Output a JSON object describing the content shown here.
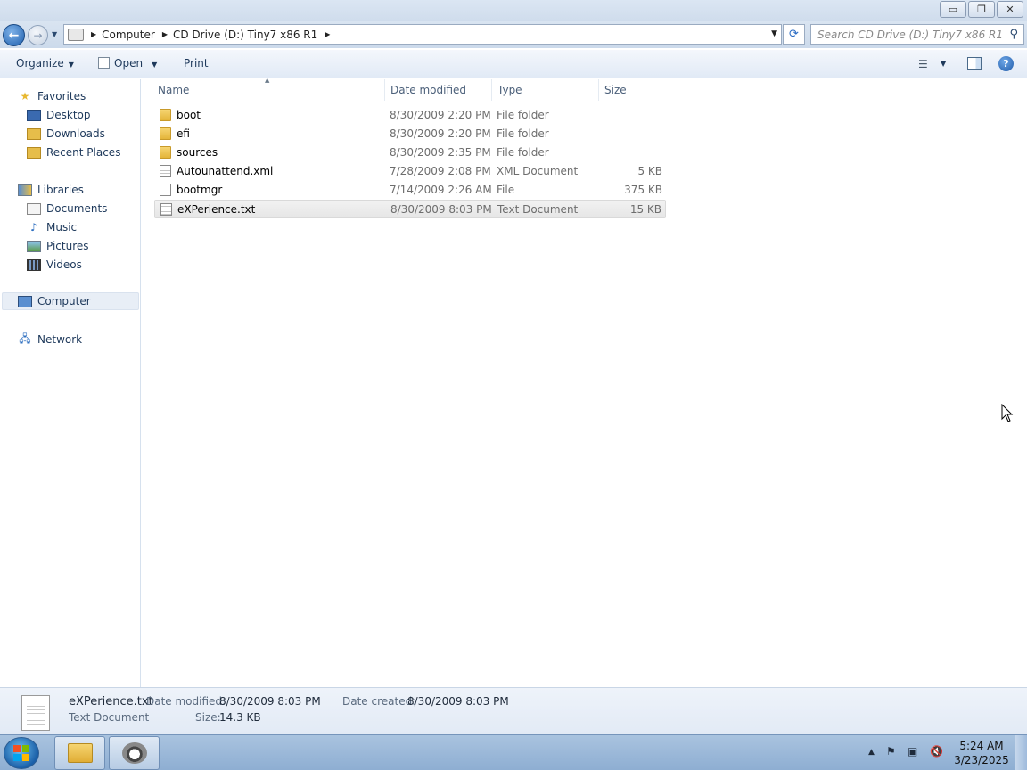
{
  "window": {
    "buttons": {
      "minimize": "▭",
      "restore": "❐",
      "close": "✕"
    }
  },
  "address": {
    "crumbs": [
      "Computer",
      "CD Drive (D:) Tiny7 x86 R1"
    ],
    "search_placeholder": "Search CD Drive (D:) Tiny7 x86 R1"
  },
  "toolbar": {
    "organize": "Organize",
    "open": "Open",
    "print": "Print"
  },
  "nav": {
    "favorites": "Favorites",
    "desktop": "Desktop",
    "downloads": "Downloads",
    "recent": "Recent Places",
    "libraries": "Libraries",
    "documents": "Documents",
    "music": "Music",
    "pictures": "Pictures",
    "videos": "Videos",
    "computer": "Computer",
    "network": "Network"
  },
  "columns": {
    "name": "Name",
    "date": "Date modified",
    "type": "Type",
    "size": "Size"
  },
  "files": [
    {
      "name": "boot",
      "date": "8/30/2009 2:20 PM",
      "type": "File folder",
      "size": "",
      "icon": "folder-icon"
    },
    {
      "name": "efi",
      "date": "8/30/2009 2:20 PM",
      "type": "File folder",
      "size": "",
      "icon": "folder-icon"
    },
    {
      "name": "sources",
      "date": "8/30/2009 2:35 PM",
      "type": "File folder",
      "size": "",
      "icon": "folder-icon"
    },
    {
      "name": "Autounattend.xml",
      "date": "7/28/2009 2:08 PM",
      "type": "XML Document",
      "size": "5 KB",
      "icon": "xml-file-icon"
    },
    {
      "name": "bootmgr",
      "date": "7/14/2009 2:26 AM",
      "type": "File",
      "size": "375 KB",
      "icon": "file-icon"
    },
    {
      "name": "eXPerience.txt",
      "date": "8/30/2009 8:03 PM",
      "type": "Text Document",
      "size": "15 KB",
      "icon": "text-file-icon"
    }
  ],
  "details": {
    "filename": "eXPerience.txt",
    "filetype": "Text Document",
    "modified_label": "Date modified:",
    "modified_value": "8/30/2009 8:03 PM",
    "created_label": "Date created:",
    "created_value": "8/30/2009 8:03 PM",
    "size_label": "Size:",
    "size_value": "14.3 KB"
  },
  "taskbar": {
    "time": "5:24 AM",
    "date": "3/23/2025"
  }
}
